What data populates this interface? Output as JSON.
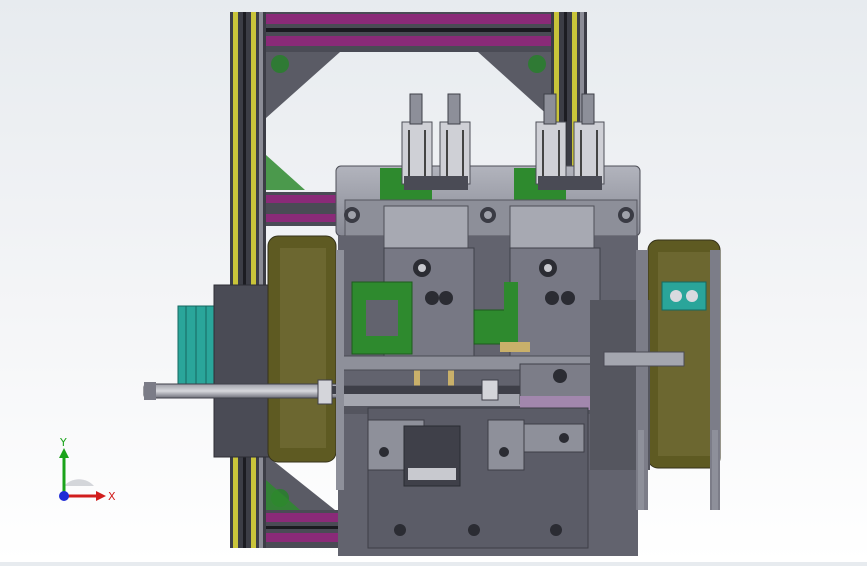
{
  "window": {
    "type": "cad-3d-viewport",
    "view": "front"
  },
  "triad": {
    "x_label": "X",
    "y_label": "Y",
    "x_color": "#d11d1d",
    "y_color": "#1aa31a",
    "z_color": "#1f2bd6"
  },
  "colors": {
    "frame_yellow": "#c9c43a",
    "frame_magenta": "#8a2a78",
    "plate_grey": "#6d6e7a",
    "dark_plate": "#4e4f5b",
    "light_metal": "#9a9ca6",
    "green_part": "#2e8a2e",
    "teal_motor": "#2aa59a",
    "olive_belt": "#5e5a22"
  },
  "model_parts": [
    "aluminum-frame",
    "cross-beam",
    "pneumatic-cylinder",
    "gripper-head",
    "slide-rail",
    "servo-motor",
    "conveyor-belt",
    "base-plate",
    "linear-actuator-rod"
  ]
}
